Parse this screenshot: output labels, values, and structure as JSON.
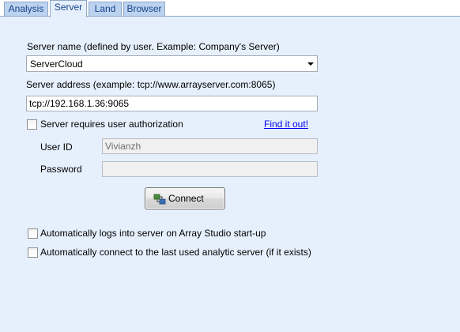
{
  "tabs": [
    {
      "label": "Analysis"
    },
    {
      "label": "Server"
    },
    {
      "label": "Land"
    },
    {
      "label": "Browser"
    }
  ],
  "active_tab": "Server",
  "server_name": {
    "label": "Server name (defined by user. Example: Company's Server)",
    "value": "ServerCloud"
  },
  "server_address": {
    "label": "Server address (example: tcp://www.arrayserver.com:8065)",
    "value": "tcp://192.168.1.36:9065"
  },
  "auth": {
    "label": "Server requires user authorization",
    "checked": false,
    "link": "Find it out!"
  },
  "user_id": {
    "label": "User ID",
    "value": "Vivianzh"
  },
  "password": {
    "label": "Password",
    "value": ""
  },
  "connect_button": {
    "label": "Connect",
    "icon": "connect-icon"
  },
  "options": [
    {
      "label": "Automatically logs into server on Array Studio start-up",
      "checked": false
    },
    {
      "label": "Automatically connect to the last used analytic server (if it exists)",
      "checked": false
    }
  ],
  "colors": {
    "panel_bg": "#e6f0fc",
    "tab_bg": "#bcd3ef",
    "tab_text": "#15428b",
    "link": "#0000ee"
  }
}
